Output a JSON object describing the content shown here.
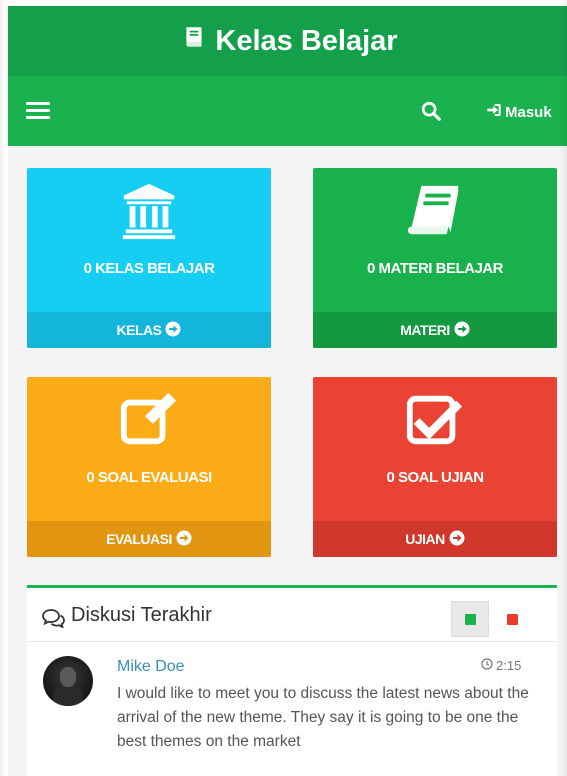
{
  "app": {
    "title": "Kelas Belajar",
    "brand_icon": "book-icon"
  },
  "navbar": {
    "menu_icon": "hamburger-icon",
    "search_icon": "search-icon",
    "login_label": "Masuk",
    "login_icon": "sign-in-icon"
  },
  "tiles": [
    {
      "icon": "institution-icon",
      "count_label": "0 KELAS BELAJAR",
      "link_label": "KELAS",
      "color": "#16cdf3"
    },
    {
      "icon": "book-icon",
      "count_label": "0 MATERI BELAJAR",
      "link_label": "MATERI",
      "color": "#18b14b"
    },
    {
      "icon": "edit-icon",
      "count_label": "0 SOAL EVALUASI",
      "link_label": "EVALUASI",
      "color": "#fbab15"
    },
    {
      "icon": "check-square-icon",
      "count_label": "0 SOAL UJIAN",
      "link_label": "UJIAN",
      "color": "#ea4334"
    }
  ],
  "discussion": {
    "title": "Diskusi Terakhir",
    "title_icon": "comments-icon",
    "controls": [
      {
        "color": "#1ab24e"
      },
      {
        "color": "#e73c2c"
      }
    ],
    "items": [
      {
        "author": "Mike Doe",
        "time": "2:15",
        "message": "I would like to meet you to discuss the latest news about the arrival of the new theme. They say it is going to be one the best themes on the market"
      }
    ]
  }
}
